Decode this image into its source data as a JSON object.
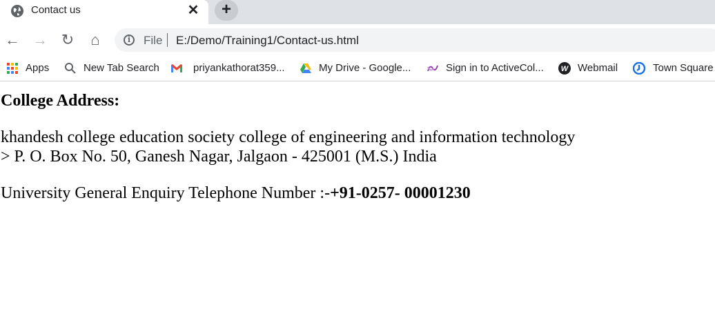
{
  "tab": {
    "title": "Contact us",
    "close_glyph": "✕",
    "favicon": "globe-icon",
    "new_tab_glyph": "+"
  },
  "toolbar": {
    "back_glyph": "←",
    "forward_glyph": "→",
    "reload_glyph": "↻",
    "home_glyph": "⌂",
    "info_glyph": "i",
    "scheme": "File",
    "url": "E:/Demo/Training1/Contact-us.html"
  },
  "bookmarks": [
    {
      "label": "Apps",
      "icon": "apps-grid-icon"
    },
    {
      "label": "New Tab Search",
      "icon": "search-icon"
    },
    {
      "label": "priyankathorat359...",
      "icon": "gmail-icon"
    },
    {
      "label": "My Drive - Google...",
      "icon": "google-drive-icon"
    },
    {
      "label": "Sign in to ActiveCol...",
      "icon": "activecollab-icon"
    },
    {
      "label": "Webmail",
      "icon": "webmail-icon"
    },
    {
      "label": "Town Square",
      "icon": "town-square-icon"
    }
  ],
  "content": {
    "heading": "College Address:",
    "address_line1": "khandesh college education society college of engineering and information technology",
    "address_line2": "> P. O. Box No. 50, Ganesh Nagar, Jalgaon - 425001 (M.S.) India",
    "phone_label": "University General Enquiry Telephone Number :-",
    "phone_number": "+91-0257- 00001230"
  },
  "colors": {
    "tabstrip_bg": "#dee1e6",
    "omnibox_bg": "#f1f3f4",
    "text": "#202124",
    "icon_gray": "#5f6368"
  }
}
